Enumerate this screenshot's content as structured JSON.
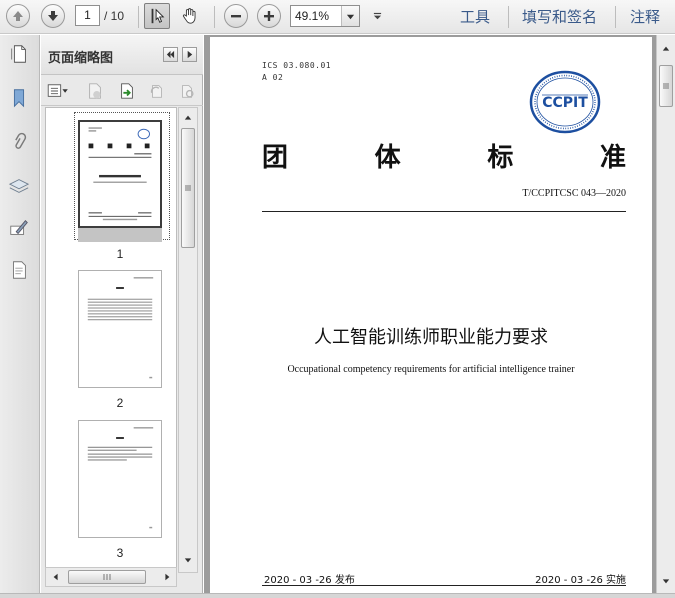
{
  "toolbar": {
    "current_page": "1",
    "total_pages": "/ 10",
    "zoom": "49.1%",
    "links": {
      "tools": "工具",
      "fill_sign": "填写和签名",
      "comment": "注释"
    }
  },
  "thumbnail_panel": {
    "title": "页面缩略图",
    "thumbnails": [
      {
        "label": "1"
      },
      {
        "label": "2"
      },
      {
        "label": "3"
      }
    ]
  },
  "document": {
    "ics": "ICS 03.080.01",
    "classification": "A 02",
    "logo_text": "CCPIT",
    "standard_chars": [
      "团",
      "体",
      "标",
      "准"
    ],
    "standard_code": "T/CCPITCSC 043—2020",
    "title_cn": "人工智能训练师职业能力要求",
    "title_en": "Occupational competency requirements for artificial intelligence trainer",
    "publish_date": "2020 - 03 -26 发布",
    "implement_date": "2020 - 03 -26 实施"
  },
  "colors": {
    "accent_link": "#3a5a8a",
    "logo_blue": "#1d4fa0"
  }
}
